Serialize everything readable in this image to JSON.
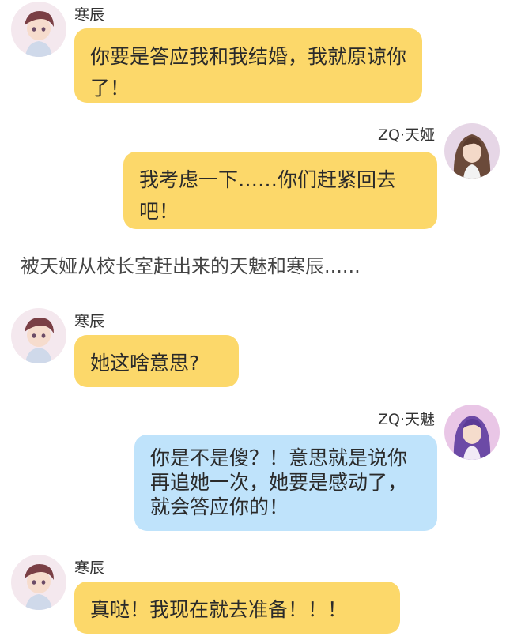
{
  "messages": [
    {
      "sender": "寒辰",
      "side": "left",
      "bubble_color": "#fcd86a",
      "text": "你要是答应我和我结婚，我就原谅你了！"
    },
    {
      "sender": "ZQ·天娅",
      "side": "right",
      "bubble_color": "#fcd86a",
      "text": "我考虑一下……你们赶紧回去吧！"
    },
    {
      "sender": "寒辰",
      "side": "left",
      "bubble_color": "#fcd86a",
      "text": "她这啥意思?"
    },
    {
      "sender": "ZQ·天魅",
      "side": "right",
      "bubble_color": "#bfe3fb",
      "text": "你是不是傻？！意思就是说你再追她一次，她要是感动了，就会答应你的！"
    },
    {
      "sender": "寒辰",
      "side": "left",
      "bubble_color": "#fcd86a",
      "text": "真哒！我现在就去准备！！！"
    }
  ],
  "narration": "被天娅从校长室赶出来的天魅和寒辰......",
  "avatars": {
    "hanchen": "boy-avatar-icon",
    "tianya": "girl-brown-hair-avatar-icon",
    "tianmei": "girl-purple-hair-avatar-icon"
  }
}
